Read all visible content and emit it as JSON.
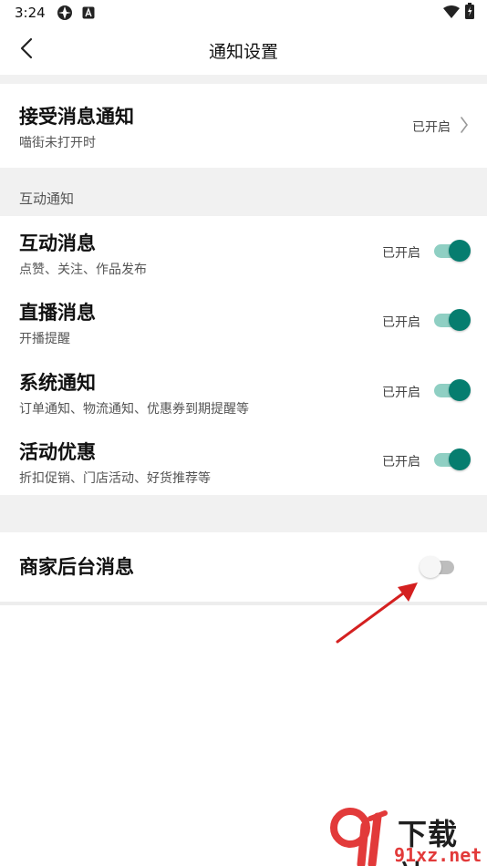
{
  "status_bar": {
    "time": "3:24"
  },
  "header": {
    "title": "通知设置",
    "back_icon": "chevron-left-icon"
  },
  "receive_notifications": {
    "title": "接受消息通知",
    "subtitle": "喵街未打开时",
    "status": "已开启"
  },
  "interaction_section": {
    "header": "互动通知",
    "items": [
      {
        "title": "互动消息",
        "subtitle": "点赞、关注、作品发布",
        "status": "已开启",
        "enabled": true
      },
      {
        "title": "直播消息",
        "subtitle": "开播提醒",
        "status": "已开启",
        "enabled": true
      },
      {
        "title": "系统通知",
        "subtitle": "订单通知、物流通知、优惠券到期提醒等",
        "status": "已开启",
        "enabled": true
      },
      {
        "title": "活动优惠",
        "subtitle": "折扣促销、门店活动、好货推荐等",
        "status": "已开启",
        "enabled": true
      }
    ]
  },
  "merchant": {
    "title": "商家后台消息",
    "enabled": false
  },
  "colors": {
    "toggle_on": "#067d6f",
    "toggle_on_track": "#8fcfc3",
    "toggle_off_track": "#bdbdbd",
    "annotation_arrow": "#d42020"
  },
  "watermark": {
    "logo_text": "下载站",
    "url": "91xz.net"
  }
}
